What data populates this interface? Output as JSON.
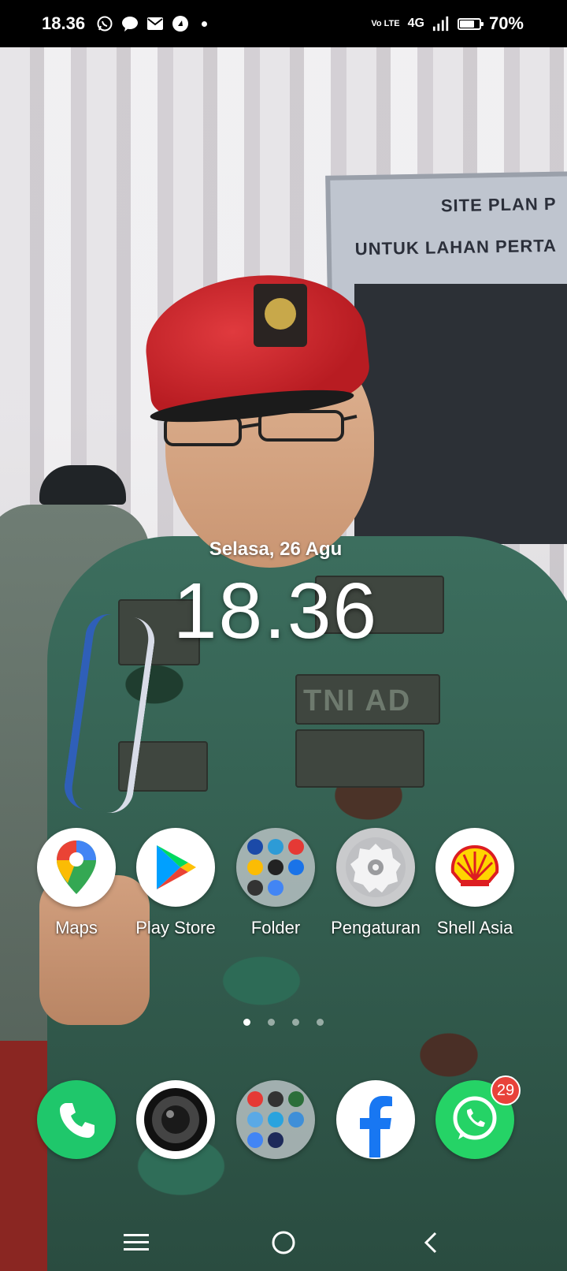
{
  "status_bar": {
    "time": "18.36",
    "volte_label": "Vo LTE",
    "network": "4G",
    "battery_percent": "70%",
    "battery_level": 0.7
  },
  "widget": {
    "date": "Selasa, 26 Agu",
    "clock": "18.36"
  },
  "wallpaper": {
    "sign_line1": "SITE PLAN P",
    "sign_line2": "UNTUK LAHAN PERTA",
    "uniform_text": "TNI AD"
  },
  "apps": [
    {
      "label": "Maps",
      "icon": "google-maps-icon"
    },
    {
      "label": "Play Store",
      "icon": "play-store-icon"
    },
    {
      "label": "Folder",
      "icon": "folder-icon"
    },
    {
      "label": "Pengaturan",
      "icon": "settings-icon"
    },
    {
      "label": "Shell Asia",
      "icon": "shell-icon"
    }
  ],
  "pages": {
    "count": 4,
    "active": 1
  },
  "dock": [
    {
      "icon": "phone-icon"
    },
    {
      "icon": "camera-icon"
    },
    {
      "icon": "folder-icon"
    },
    {
      "icon": "facebook-icon"
    },
    {
      "icon": "whatsapp-icon",
      "badge": "29"
    }
  ],
  "colors": {
    "whatsapp": "#25D366",
    "facebook": "#1877F2",
    "badge": "#E8423A",
    "beret": "#C8262C"
  }
}
